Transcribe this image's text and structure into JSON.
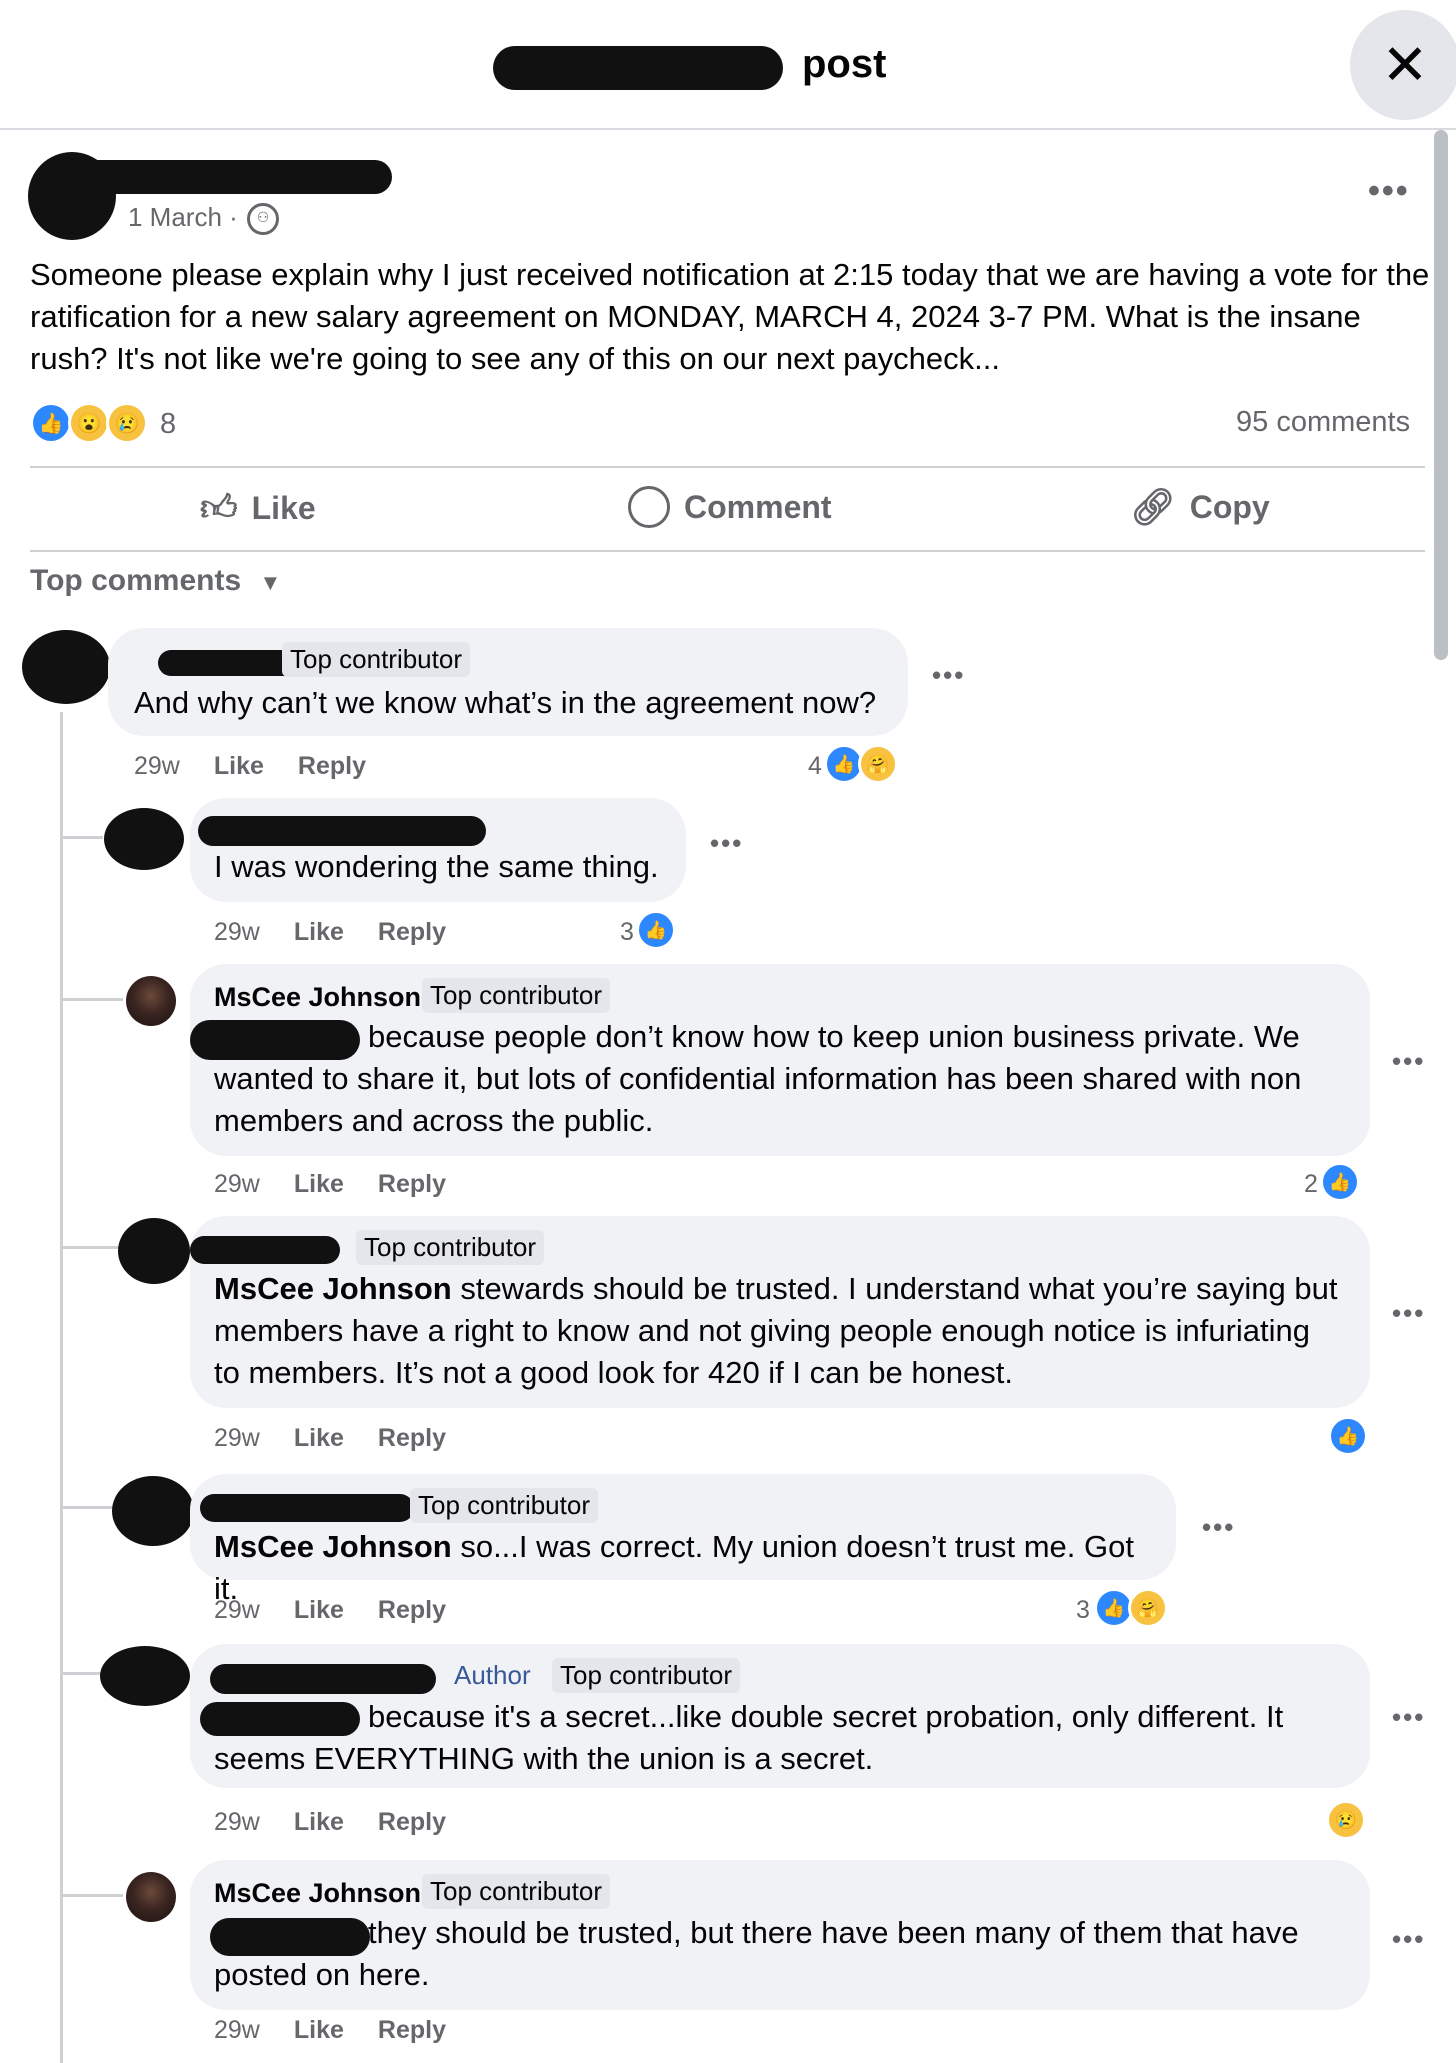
{
  "header": {
    "title_suffix": "post",
    "close_icon": "close-icon"
  },
  "post": {
    "date": "1 March ·",
    "privacy_icon": "group-members-icon",
    "menu": "•••",
    "text": "Someone please explain why I just received notification at 2:15 today that we are having a vote for the ratification for a new salary agreement on MONDAY, MARCH 4, 2024 3-7 PM. What is the insane rush? It's not like we're going to see any of this on our next paycheck...",
    "reaction_count": "8",
    "comments_count": "95 comments",
    "actions": {
      "like": "Like",
      "comment": "Comment",
      "copy": "Copy"
    }
  },
  "sort": {
    "label": "Top comments"
  },
  "comments": [
    {
      "badge": "Top contributor",
      "text": "And why can’t we know what’s in the agreement now?",
      "time": "29w",
      "like": "Like",
      "reply": "Reply",
      "reactions": "4"
    },
    {
      "text": "I was wondering the same thing.",
      "time": "29w",
      "like": "Like",
      "reply": "Reply",
      "reactions": "3"
    },
    {
      "name": "MsCee Johnson",
      "badge": "Top contributor",
      "text": "because people don’t know how to keep union business private. We wanted to share it, but lots of confidential information has been shared with non members and across the public.",
      "time": "29w",
      "like": "Like",
      "reply": "Reply",
      "reactions": "2"
    },
    {
      "badge": "Top contributor",
      "mention": "MsCee Johnson",
      "text": " stewards should be trusted. I understand what you’re saying but members have a right to know and not giving people enough notice is infuriating to members. It’s not a good look for 420 if I can be honest.",
      "time": "29w",
      "like": "Like",
      "reply": "Reply"
    },
    {
      "badge": "Top contributor",
      "mention": "MsCee Johnson",
      "text": " so...I was correct. My union doesn’t trust me. Got it.",
      "time": "29w",
      "like": "Like",
      "reply": "Reply",
      "reactions": "3"
    },
    {
      "author_badge": "Author",
      "badge": "Top contributor",
      "text": "because it's a secret...like double secret probation, only different. It seems EVERYTHING with the union is a secret.",
      "time": "29w",
      "like": "Like",
      "reply": "Reply"
    },
    {
      "name": "MsCee Johnson",
      "badge": "Top contributor",
      "text": "they should be trusted, but there have been many of them that have posted on here.",
      "time": "29w",
      "like": "Like",
      "reply": "Reply"
    }
  ],
  "colors": {
    "accent": "#2d88ff",
    "bubble": "#f0f2f5",
    "meta": "#65676b"
  }
}
